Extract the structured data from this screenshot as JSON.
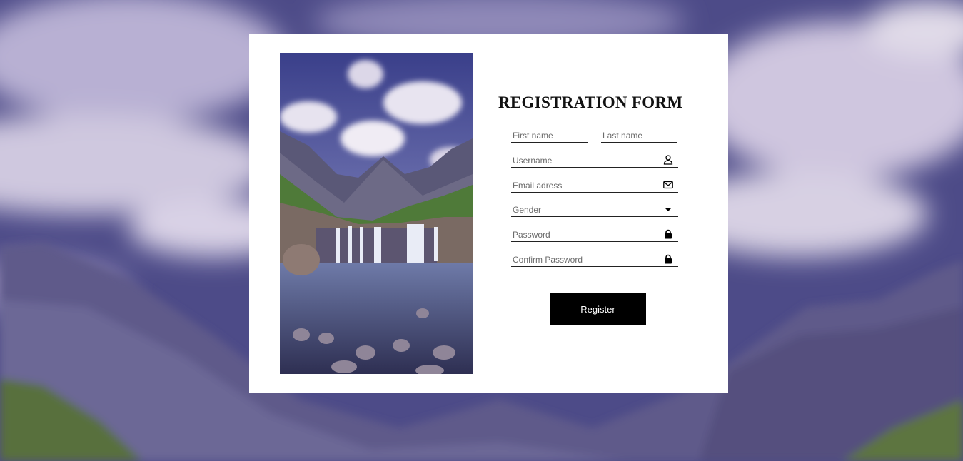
{
  "form": {
    "title": "REGISTRATION FORM",
    "first_name_placeholder": "First name",
    "last_name_placeholder": "Last name",
    "username_placeholder": "Username",
    "email_placeholder": "Email adress",
    "gender_label": "Gender",
    "password_placeholder": "Password",
    "confirm_password_placeholder": "Confirm Password",
    "register_label": "Register"
  },
  "icons": {
    "username": "user-icon",
    "email": "envelope-icon",
    "gender": "caret-down-icon",
    "password": "lock-icon",
    "confirm_password": "lock-icon"
  },
  "colors": {
    "button_bg": "#000000",
    "button_text": "#ffffff",
    "card_bg": "#ffffff"
  }
}
